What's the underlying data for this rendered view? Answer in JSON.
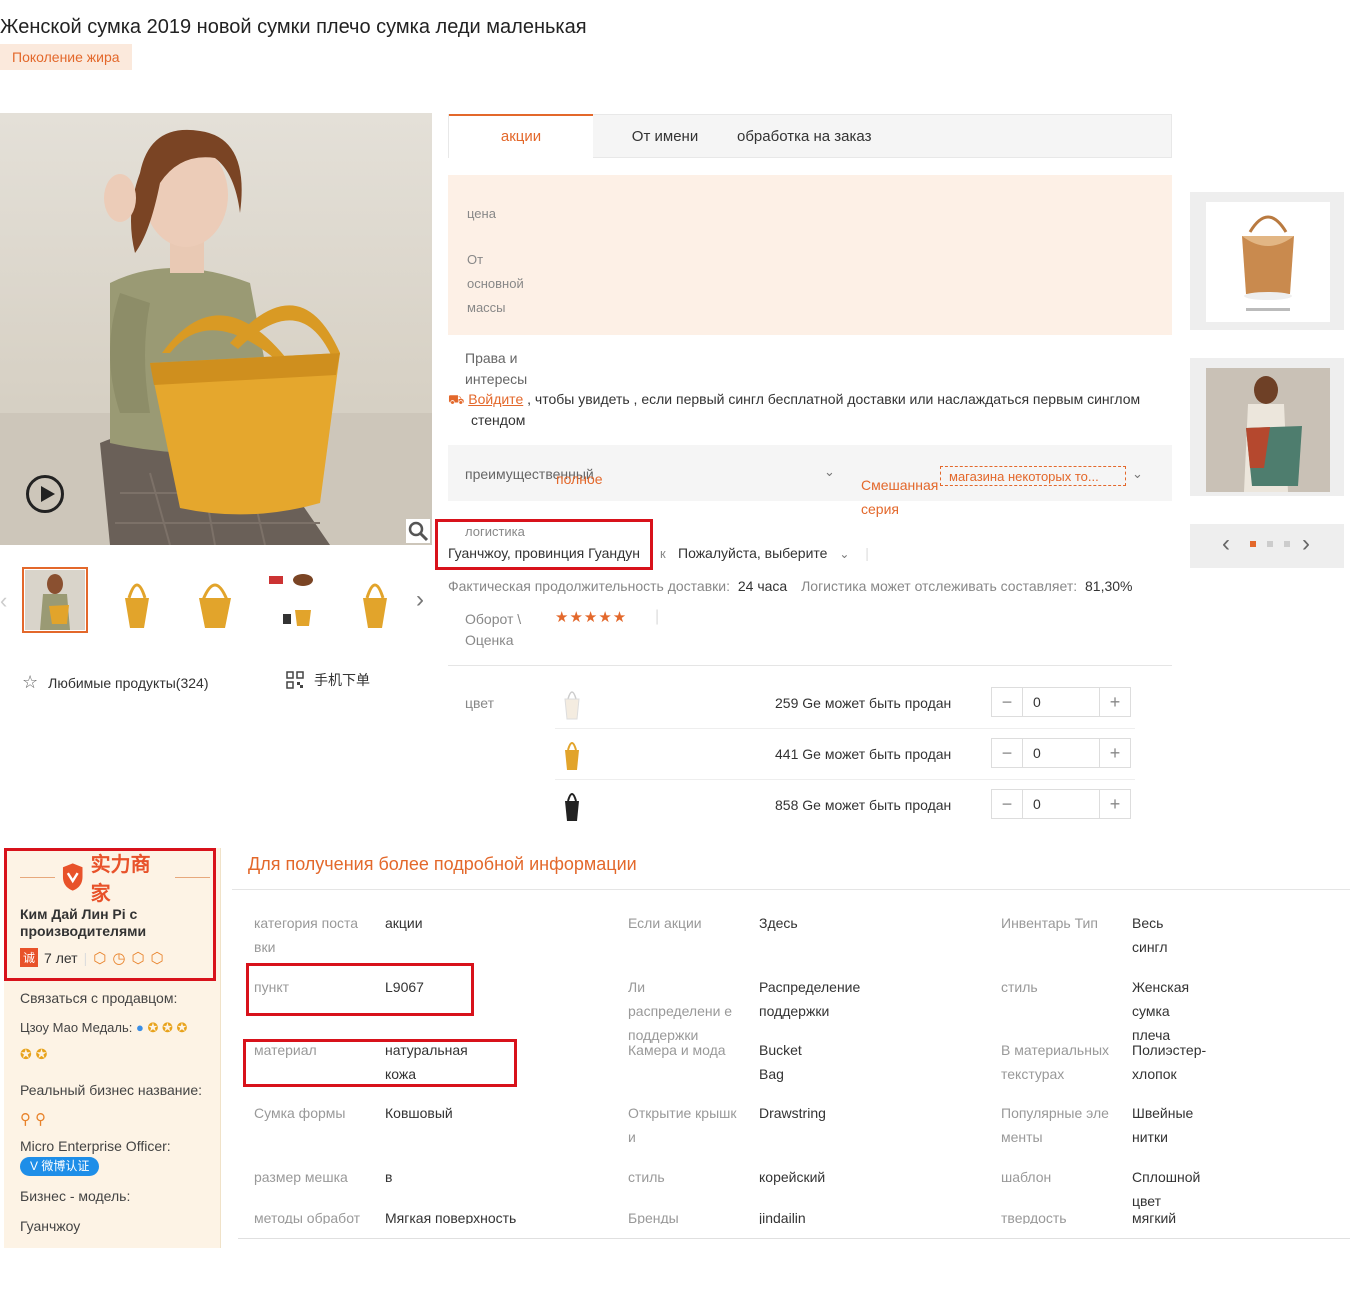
{
  "product": {
    "title": "Женской сумка 2019 новой сумки  плечо сумка леди маленькая",
    "tag": "Поколение жира"
  },
  "gallery": {
    "favorites": "Любимые продукты(324)",
    "mobile_order": "手机下单"
  },
  "tabs": [
    "акции",
    "От имени",
    "обработка на заказ"
  ],
  "price_box": {
    "price_label": "цена",
    "from_label_1": "От",
    "from_label_2": "основной",
    "from_label_3": "массы"
  },
  "rights": {
    "label_1": "Права и",
    "label_2": "интересы",
    "login_link": "Войдите",
    "login_text": " , чтобы увидеть , если первый сингл бесплатной доставки или наслаждаться первым синглом",
    "login_text_2": "стендом"
  },
  "advantages": {
    "label": "преимущественный",
    "full": "полное",
    "mixed_1": "Смешанная",
    "mixed_2": "серия",
    "store_select": "магазина некоторых то..."
  },
  "logistics": {
    "label": "логистика",
    "from": "Гуанчжоу, провинция Гуандун",
    "to_label": "к",
    "to_select": "Пожалуйста, выберите",
    "delivery_label": "Фактическая продолжительность доставки:",
    "delivery_value": "24 часа",
    "tracking_label": "Логистика может отслеживать составляет:",
    "tracking_value": "81,30%"
  },
  "rating": {
    "label_1": "Оборот \\",
    "label_2": "Оценка",
    "stars": "★★★★★"
  },
  "colors": {
    "label": "цвет",
    "rows": [
      {
        "stock": "259",
        "unit": "Ge может быть продан",
        "qty": "0"
      },
      {
        "stock": "441",
        "unit": "Ge может быть продан",
        "qty": "0"
      },
      {
        "stock": "858",
        "unit": "Ge может быть продан",
        "qty": "0"
      }
    ]
  },
  "seller": {
    "badge": "实力商家",
    "name": "Ким Дай Лин Pi с производителями",
    "years_badge": "诚",
    "years": "7 лет",
    "contact_label": "Связаться с продавцом:",
    "contact_names": "Цзоу Мао Медаль:",
    "business_name_label": "Реальный бизнес название:",
    "micro_label": "Micro Enterprise Officer:",
    "weibo": "V 微博认证",
    "model_label": "Бизнес - модель:",
    "location": "Гуанчжоу"
  },
  "details": {
    "title": "Для получения более подробной информации",
    "rows": [
      [
        [
          "категория поста вки",
          "акции"
        ],
        [
          "Если акции",
          "Здесь"
        ],
        [
          "Инвентарь Тип",
          "Весь сингл"
        ]
      ],
      [
        [
          "пункт",
          "L9067"
        ],
        [
          "Ли распределени е поддержки",
          "Распределение поддержки"
        ],
        [
          "стиль",
          "Женская сумка плеча"
        ]
      ],
      [
        [
          "материал",
          "натуральная кожа"
        ],
        [
          "Камера и мода",
          "Bucket Bag"
        ],
        [
          "В материальных текстурах",
          "Полиэстер-хлопок"
        ]
      ],
      [
        [
          "Сумка формы",
          "Ковшовый"
        ],
        [
          "Открытие крышк и",
          "Drawstring"
        ],
        [
          "Популярные эле менты",
          "Швейные нитки"
        ]
      ],
      [
        [
          "размер мешка",
          "в"
        ],
        [
          "стиль",
          "корейский"
        ],
        [
          "шаблон",
          "Сплошной цвет"
        ]
      ],
      [
        [
          "методы обработ",
          "Мягкая поверхность"
        ],
        [
          "Бренды",
          "jindailin"
        ],
        [
          "твердость",
          "мягкий"
        ]
      ]
    ]
  },
  "colors_theme": {
    "accent": "#e3682b",
    "highlight": "#d8121b",
    "price_bg": "#fdf0e6"
  }
}
